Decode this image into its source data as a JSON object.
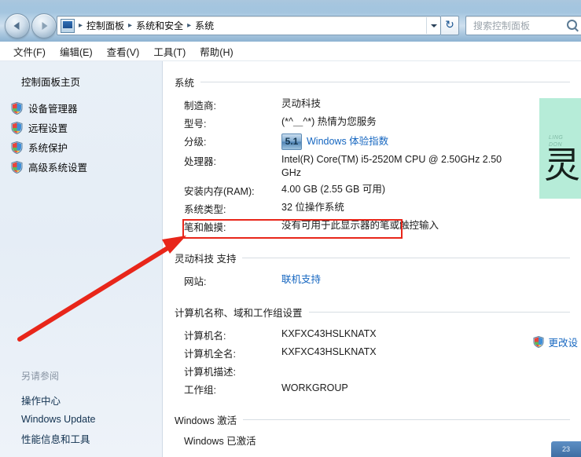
{
  "window": {
    "breadcrumb": [
      "控制面板",
      "系统和安全",
      "系统"
    ],
    "breadcrumb_separator": "▸",
    "refresh_label": "↻",
    "back_label": "后退",
    "forward_label": "前进"
  },
  "search": {
    "placeholder": "搜索控制面板",
    "value": ""
  },
  "menubar": {
    "items": [
      {
        "label": "文件(F)"
      },
      {
        "label": "编辑(E)"
      },
      {
        "label": "查看(V)"
      },
      {
        "label": "工具(T)"
      },
      {
        "label": "帮助(H)"
      }
    ]
  },
  "sidebar": {
    "home_label": "控制面板主页",
    "items": [
      {
        "label": "设备管理器",
        "icon": "shield-icon"
      },
      {
        "label": "远程设置",
        "icon": "shield-icon"
      },
      {
        "label": "系统保护",
        "icon": "shield-icon"
      },
      {
        "label": "高级系统设置",
        "icon": "shield-icon"
      }
    ],
    "see_also_title": "另请参阅",
    "see_also": [
      {
        "label": "操作中心"
      },
      {
        "label": "Windows Update"
      },
      {
        "label": "性能信息和工具"
      }
    ]
  },
  "content": {
    "sections": [
      {
        "title": "系统",
        "rows": [
          {
            "label": "制造商:",
            "value": "灵动科技",
            "type": "text"
          },
          {
            "label": "型号:",
            "value": "(*^＿^*) 热情为您服务",
            "type": "text"
          },
          {
            "label": "分级:",
            "value": "Windows 体验指数",
            "type": "rating",
            "badge": "5.1"
          },
          {
            "label": "处理器:",
            "value": "Intel(R) Core(TM) i5-2520M CPU @ 2.50GHz   2.50 GHz",
            "type": "text"
          },
          {
            "label": "安装内存(RAM):",
            "value": "4.00 GB (2.55 GB 可用)",
            "type": "text"
          },
          {
            "label": "系统类型:",
            "value": "32 位操作系统",
            "type": "text",
            "highlighted": true
          },
          {
            "label": "笔和触摸:",
            "value": "没有可用于此显示器的笔或触控输入",
            "type": "text"
          }
        ]
      },
      {
        "title": "灵动科技 支持",
        "rows": [
          {
            "label": "网站:",
            "value": "联机支持",
            "type": "link"
          }
        ]
      },
      {
        "title": "计算机名称、域和工作组设置",
        "rows": [
          {
            "label": "计算机名:",
            "value": "KXFXC43HSLKNATX",
            "type": "text"
          },
          {
            "label": "计算机全名:",
            "value": "KXFXC43HSLKNATX",
            "type": "text"
          },
          {
            "label": "计算机描述:",
            "value": "",
            "type": "text"
          },
          {
            "label": "工作组:",
            "value": "WORKGROUP",
            "type": "text"
          }
        ]
      },
      {
        "title": "Windows 激活",
        "rows": [
          {
            "label": "",
            "value": "Windows 已激活",
            "type": "status"
          }
        ]
      }
    ],
    "change_settings_label": "更改设",
    "logo": {
      "en_line1": "LING",
      "en_line2": "DON",
      "cn": "灵"
    },
    "tray_label": "23"
  },
  "annotation": {
    "box_color": "#e8261a",
    "arrow_color": "#e8261a",
    "target_label": "系统类型"
  }
}
